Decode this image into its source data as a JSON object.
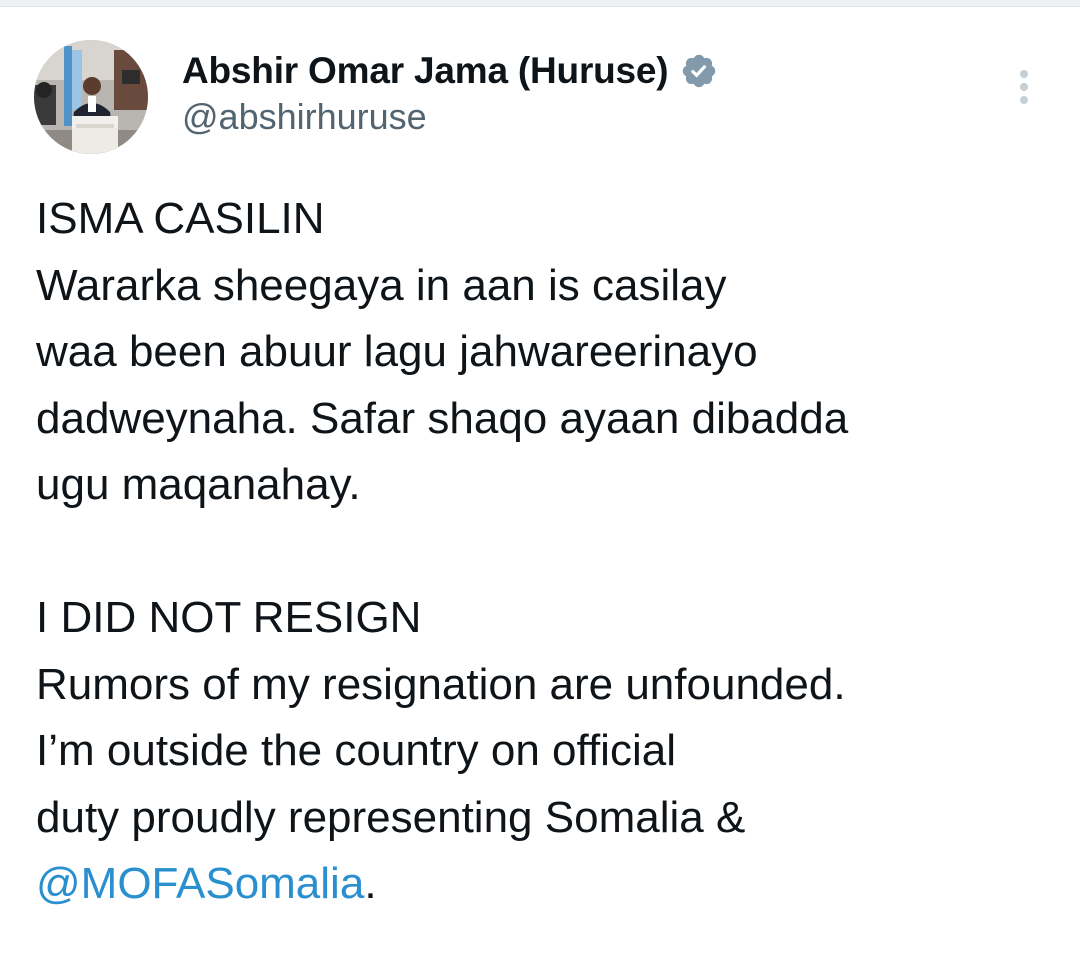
{
  "author": {
    "display_name": "Abshir Omar Jama (Huruse)",
    "handle": "@abshirhuruse",
    "verified_icon": "verified-badge-icon"
  },
  "tweet": {
    "paragraph_1": {
      "heading": "ISMA CASILIN",
      "lines": [
        "Wararka sheegaya in aan is casilay",
        "waa been abuur lagu jahwareerinayo",
        "dadweynaha. Safar shaqo ayaan dibadda",
        "ugu maqanahay."
      ]
    },
    "paragraph_2": {
      "heading": "I DID NOT RESIGN",
      "lines": [
        "Rumors of my resignation are unfounded.",
        "I’m outside the country on official",
        "duty proudly representing Somalia &"
      ],
      "mention": "@MOFASomalia",
      "trailing": "."
    }
  },
  "colors": {
    "text": "#0f1419",
    "secondary": "#536471",
    "mention": "#2a8fce",
    "verified_badge": "#829aab"
  },
  "icons": {
    "more": "more-options-icon"
  }
}
